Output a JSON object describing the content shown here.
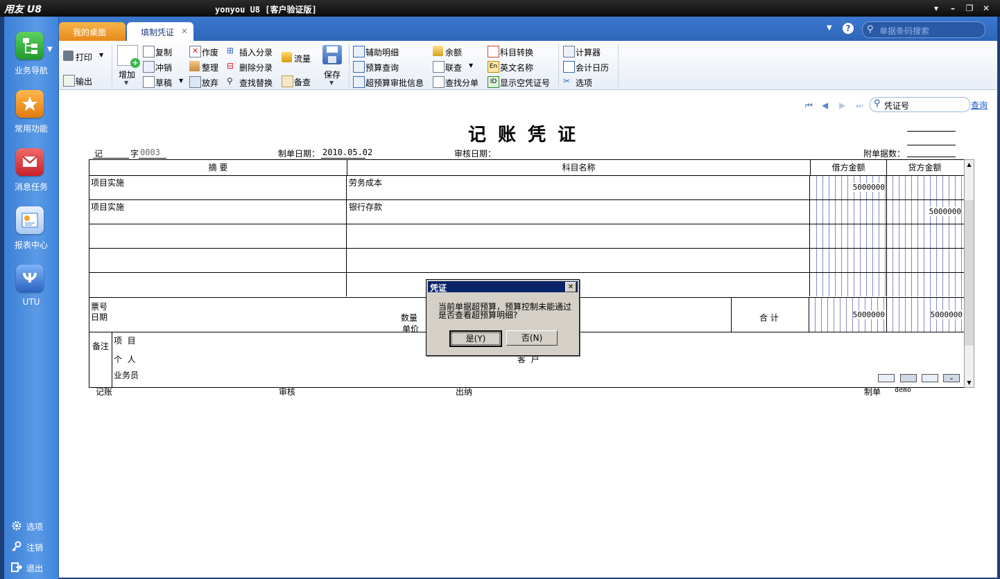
{
  "window": {
    "logo": "用友 U8",
    "title": "yonyou U8 [客户验证版]"
  },
  "sidebar": {
    "items": [
      {
        "label": "业务导航",
        "icon": "business-nav-icon"
      },
      {
        "label": "常用功能",
        "icon": "favorites-icon"
      },
      {
        "label": "消息任务",
        "icon": "message-icon"
      },
      {
        "label": "报表中心",
        "icon": "report-icon"
      },
      {
        "label": "UTU",
        "icon": "utu-icon"
      }
    ],
    "bottom": [
      {
        "label": "选项",
        "icon": "gear-icon"
      },
      {
        "label": "注销",
        "icon": "key-icon"
      },
      {
        "label": "退出",
        "icon": "exit-icon"
      }
    ]
  },
  "tabs": [
    {
      "label": "我的桌面"
    },
    {
      "label": "填制凭证"
    }
  ],
  "search": {
    "placeholder": "单据条码搜索"
  },
  "toolbar": {
    "print": "打印",
    "export": "输出",
    "add": "增加",
    "copy": "复制",
    "reverse": "冲销",
    "draft": "草稿",
    "void": "作废",
    "organize": "整理",
    "discard": "放弃",
    "insert_entry": "插入分录",
    "delete_entry": "删除分录",
    "find_replace": "查找替换",
    "flow": "流量",
    "backup": "备查",
    "save": "保存",
    "aux_detail": "辅助明细",
    "budget_query": "预算查询",
    "over_budget_info": "超预算审批信息",
    "balance": "余额",
    "linked_query": "联查",
    "find_split": "查找分单",
    "account_convert": "科目转换",
    "english_name": "英文名称",
    "show_empty_no": "显示空凭证号",
    "calculator": "计算器",
    "calendar": "会计日历",
    "options": "选项"
  },
  "voucher_nav": {
    "search_value": "凭证号",
    "query": "查询"
  },
  "voucher": {
    "title": "记 账 凭 证",
    "type": "记",
    "number_label": "字",
    "number": "0003",
    "date_label": "制单日期：",
    "date": "2010.05.02",
    "audit_date_label": "审核日期：",
    "attachments_label": "附单据数：",
    "headers": {
      "summary": "摘 要",
      "account": "科目名称",
      "debit": "借方金额",
      "credit": "贷方金额"
    },
    "rows": [
      {
        "summary": "项目实施",
        "account": "劳务成本",
        "debit": "5000000",
        "credit": ""
      },
      {
        "summary": "项目实施",
        "account": "银行存款",
        "debit": "",
        "credit": "5000000"
      },
      {
        "summary": "",
        "account": "",
        "debit": "",
        "credit": ""
      },
      {
        "summary": "",
        "account": "",
        "debit": "",
        "credit": ""
      },
      {
        "summary": "",
        "account": "",
        "debit": "",
        "credit": ""
      }
    ],
    "ticket_no_label": "票号",
    "date2_label": "日期",
    "quantity_label": "数量",
    "unit_price_label": "单价",
    "total_label": "合 计",
    "total_debit": "5000000",
    "total_credit": "5000000",
    "remark_label": "备注",
    "project_label": "项  目",
    "person_label": "个  人",
    "customer_label": "客  户",
    "salesman_label": "业务员",
    "bookkeeper_label": "记账",
    "auditor_label": "审核",
    "cashier_label": "出纳",
    "maker_label": "制单",
    "maker": "demo"
  },
  "dialog": {
    "title": "凭证",
    "message_line1": "当前单据超预算，预算控制未能通过",
    "message_line2": "是否查看超预算明细?",
    "yes": "是(Y)",
    "no": "否(N)"
  },
  "colors": {
    "accent": "#2e66b8",
    "tab_orange": "#e8891a",
    "dialog_title": "#0a246a"
  }
}
